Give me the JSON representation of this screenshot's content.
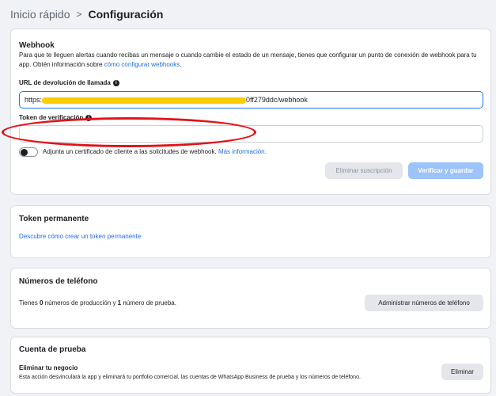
{
  "breadcrumb": {
    "parent": "Inicio rápido",
    "separator": ">",
    "current": "Configuración"
  },
  "webhook": {
    "title": "Webhook",
    "description": "Para que te lleguen alertas cuando recibas un mensaje o cuando cambie el estado de un mensaje, tienes que configurar un punto de conexión de webhook para tu app. Obtén información sobre",
    "description_link": "cómo configurar webhooks",
    "description_end": ".",
    "callback_label": "URL de devolución de llamada",
    "callback_prefix": "https:",
    "callback_suffix": "0ff279ddc/webhook",
    "token_label": "Token de verificación",
    "token_value": "",
    "cert_text": "Adjunta un certificado de cliente a las solicitudes de webhook.",
    "cert_link": "Más información.",
    "unsubscribe_label": "Eliminar suscripción",
    "verify_label": "Verificar y guardar"
  },
  "permanent_token": {
    "title": "Token permanente",
    "link": "Descubre cómo crear un token permanente"
  },
  "phones": {
    "title": "Números de teléfono",
    "text_pre": "Tienes ",
    "production_count": "0",
    "text_mid": " números de producción y ",
    "test_count": "1",
    "text_post": " número de prueba.",
    "manage_label": "Administrar números de teléfono"
  },
  "test_account": {
    "title": "Cuenta de prueba",
    "subtitle": "Eliminar tu negocio",
    "description": "Esta acción desvinculará la app y eliminará tu portfolio comercial, las cuentas de WhatsApp Business de prueba y los números de teléfono.",
    "delete_label": "Eliminar"
  },
  "colors": {
    "accent": "#1877f2",
    "link": "#216fdb",
    "annotation": "#e0141b",
    "redaction": "#ffcc00"
  }
}
